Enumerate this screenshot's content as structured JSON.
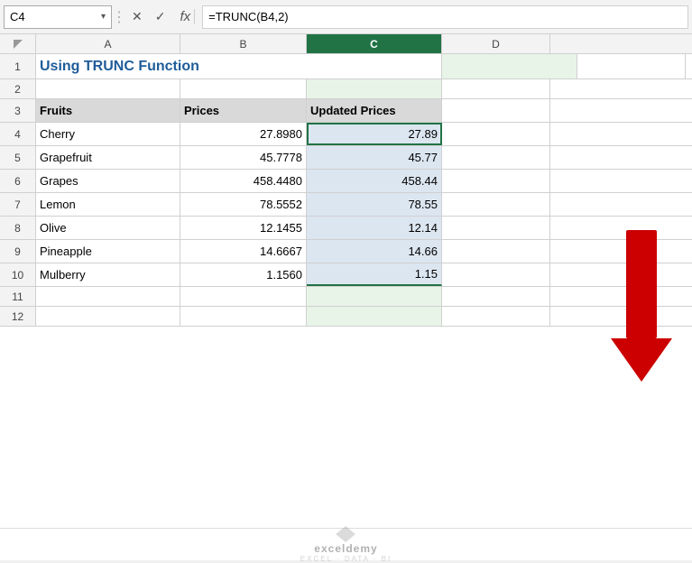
{
  "nameBox": {
    "value": "C4",
    "dropdownArrow": "▾"
  },
  "formulaBar": {
    "formula": "=TRUNC(B4,2)",
    "fxLabel": "fx"
  },
  "columns": [
    {
      "id": "row-num",
      "label": "",
      "width": 40
    },
    {
      "id": "A",
      "label": "A",
      "width": 160
    },
    {
      "id": "B",
      "label": "B",
      "width": 140
    },
    {
      "id": "C",
      "label": "C",
      "width": 150
    },
    {
      "id": "D",
      "label": "D",
      "width": 120
    }
  ],
  "rows": [
    {
      "rowNum": "1",
      "cells": [
        {
          "value": "Using TRUNC Function",
          "style": "title-blue",
          "colspan": 3
        },
        {
          "value": ""
        },
        {
          "value": ""
        }
      ]
    },
    {
      "rowNum": "2",
      "cells": [
        {
          "value": ""
        },
        {
          "value": ""
        },
        {
          "value": ""
        },
        {
          "value": ""
        }
      ]
    },
    {
      "rowNum": "3",
      "cells": [
        {
          "value": "Fruits",
          "style": "header-cell bold"
        },
        {
          "value": "Prices",
          "style": "header-cell bold"
        },
        {
          "value": "Updated Prices",
          "style": "header-cell bold c-data"
        },
        {
          "value": ""
        }
      ]
    },
    {
      "rowNum": "4",
      "cells": [
        {
          "value": "Cherry"
        },
        {
          "value": "27.8980",
          "style": "right-align"
        },
        {
          "value": "27.89",
          "style": "right-align c-data active-cell"
        },
        {
          "value": ""
        }
      ]
    },
    {
      "rowNum": "5",
      "cells": [
        {
          "value": "Grapefruit"
        },
        {
          "value": "45.7778",
          "style": "right-align"
        },
        {
          "value": "45.77",
          "style": "right-align c-data"
        },
        {
          "value": ""
        }
      ]
    },
    {
      "rowNum": "6",
      "cells": [
        {
          "value": "Grapes"
        },
        {
          "value": "458.4480",
          "style": "right-align"
        },
        {
          "value": "458.44",
          "style": "right-align c-data"
        },
        {
          "value": ""
        }
      ]
    },
    {
      "rowNum": "7",
      "cells": [
        {
          "value": "Lemon"
        },
        {
          "value": "78.5552",
          "style": "right-align"
        },
        {
          "value": "78.55",
          "style": "right-align c-data"
        },
        {
          "value": ""
        }
      ]
    },
    {
      "rowNum": "8",
      "cells": [
        {
          "value": "Olive"
        },
        {
          "value": "12.1455",
          "style": "right-align"
        },
        {
          "value": "12.14",
          "style": "right-align c-data"
        },
        {
          "value": ""
        }
      ]
    },
    {
      "rowNum": "9",
      "cells": [
        {
          "value": "Pineapple"
        },
        {
          "value": "14.6667",
          "style": "right-align"
        },
        {
          "value": "14.66",
          "style": "right-align c-data"
        },
        {
          "value": ""
        }
      ]
    },
    {
      "rowNum": "10",
      "cells": [
        {
          "value": "Mulberry"
        },
        {
          "value": "1.1560",
          "style": "right-align"
        },
        {
          "value": "1.15",
          "style": "right-align c-data"
        },
        {
          "value": ""
        }
      ]
    },
    {
      "rowNum": "11",
      "cells": [
        {
          "value": ""
        },
        {
          "value": ""
        },
        {
          "value": ""
        },
        {
          "value": ""
        }
      ]
    },
    {
      "rowNum": "12",
      "cells": [
        {
          "value": ""
        },
        {
          "value": ""
        },
        {
          "value": ""
        },
        {
          "value": ""
        }
      ]
    }
  ],
  "logo": {
    "name": "exceldemy",
    "tagline": "EXCEL · DATA · BI"
  },
  "icons": {
    "cancel": "✕",
    "confirm": "✓",
    "dots": "⋮"
  }
}
